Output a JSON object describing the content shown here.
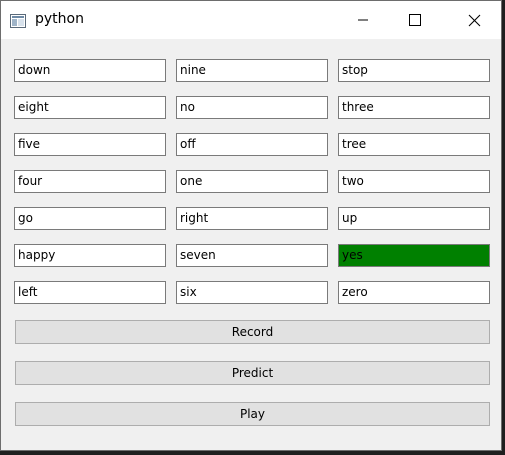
{
  "window": {
    "title": "python",
    "icon": "app-window-icon"
  },
  "grid": {
    "rows": [
      [
        "down",
        "nine",
        "stop"
      ],
      [
        "eight",
        "no",
        "three"
      ],
      [
        "five",
        "off",
        "tree"
      ],
      [
        "four",
        "one",
        "two"
      ],
      [
        "go",
        "right",
        "up"
      ],
      [
        "happy",
        "seven",
        "yes"
      ],
      [
        "left",
        "six",
        "zero"
      ]
    ],
    "highlighted": "yes",
    "highlight_color": "#008000"
  },
  "buttons": {
    "record_label": "Record",
    "predict_label": "Predict",
    "play_label": "Play"
  }
}
